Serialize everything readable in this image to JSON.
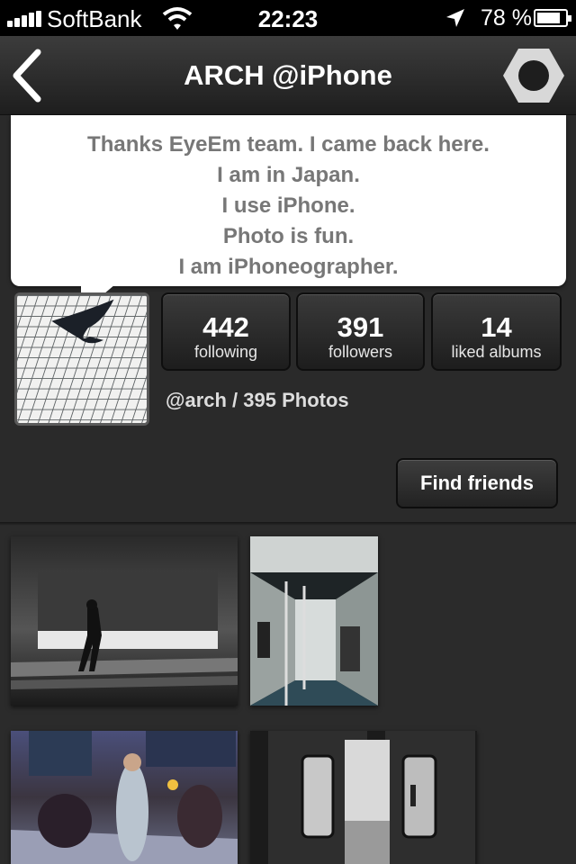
{
  "status_bar": {
    "carrier": "SoftBank",
    "time": "22:23",
    "battery_percent": "78 %",
    "battery_level": 0.78,
    "icons": [
      "signal-icon",
      "wifi-icon",
      "location-icon",
      "battery-icon"
    ]
  },
  "navbar": {
    "title": "ARCH @iPhone",
    "back_icon": "chevron-left-icon",
    "settings_icon": "hexagon-settings-icon"
  },
  "bio": {
    "lines": [
      "Thanks EyeEm team. I came back here.",
      "I am in Japan.",
      "I use iPhone.",
      "Photo is fun.",
      "I am iPhoneographer."
    ]
  },
  "profile": {
    "stats": [
      {
        "value": "442",
        "label": "following"
      },
      {
        "value": "391",
        "label": "followers"
      },
      {
        "value": "14",
        "label": "liked albums"
      }
    ],
    "handle_line": "@arch / 395 Photos"
  },
  "actions": {
    "find_friends": "Find friends"
  },
  "colors": {
    "background": "#2a2a2a",
    "navbar": "#2e2e2e",
    "bubble": "#ffffff",
    "bubble_text": "#777777"
  }
}
